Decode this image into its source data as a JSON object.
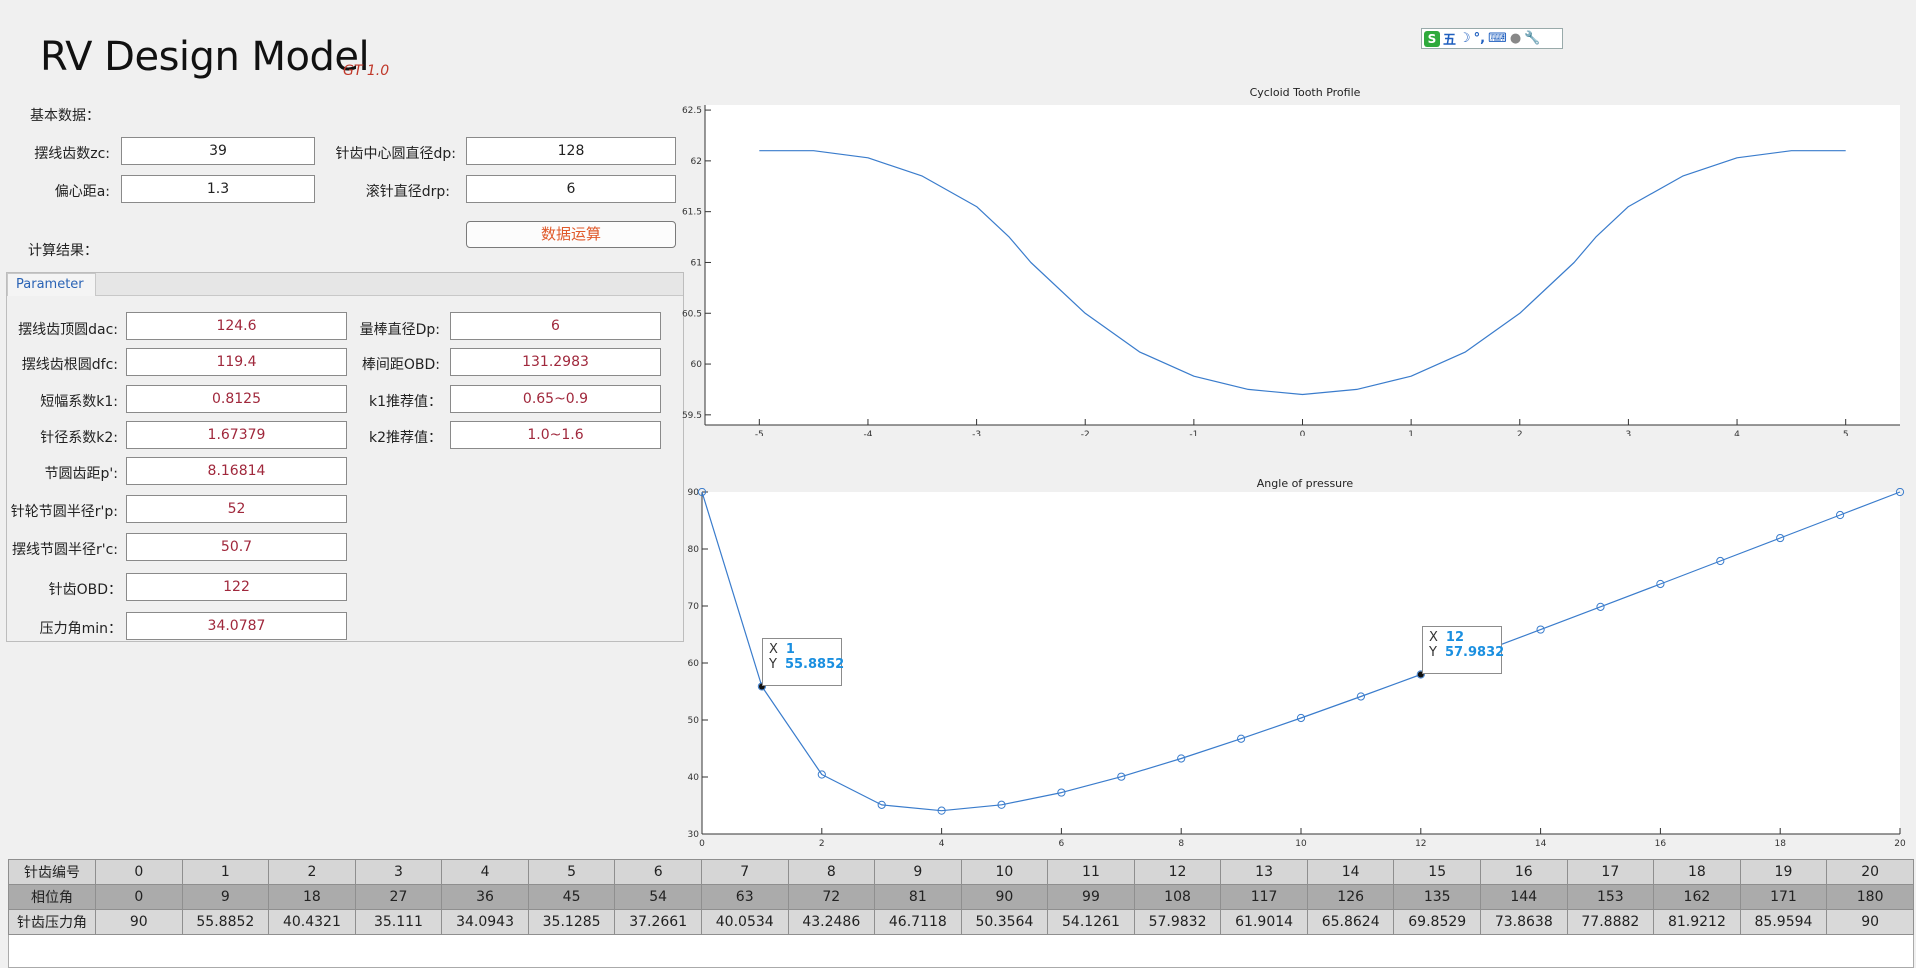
{
  "app": {
    "title": "RV Design Model",
    "version": "GT 1.0"
  },
  "ime": {
    "logo": "S",
    "mode": "五",
    "moon": "☽",
    "punct": "°,",
    "keyboard": "⌨",
    "user": "●",
    "tool": "🔧"
  },
  "basic": {
    "heading": "基本数据：",
    "zc_label": "摆线齿数zc:",
    "zc": "39",
    "dp_label": "针齿中心圆直径dp:",
    "dp": "128",
    "a_label": "偏心距a:",
    "a": "1.3",
    "drp_label": "滚针直径drp:",
    "drp": "6",
    "calc_button": "数据运算"
  },
  "results": {
    "heading": "计算结果：",
    "tab": "Parameter",
    "dac_label": "摆线齿顶圆dac:",
    "dac": "124.6",
    "Dp_label": "量棒直径Dp:",
    "Dp": "6",
    "dfc_label": "摆线齿根圆dfc:",
    "dfc": "119.4",
    "OBD_label": "棒间距OBD:",
    "OBD": "131.2983",
    "k1_label": "短幅系数k1:",
    "k1": "0.8125",
    "k1r_label": "k1推荐值：",
    "k1r": "0.65~0.9",
    "k2_label": "针径系数k2:",
    "k2": "1.67379",
    "k2r_label": "k2推荐值：",
    "k2r": "1.0~1.6",
    "pitch_label": "节圆齿距p':",
    "pitch": "8.16814",
    "rp_label": "针轮节圆半径r'p:",
    "rp": "52",
    "rc_label": "摆线节圆半径r'c:",
    "rc": "50.7",
    "pinOBD_label": "针齿OBD：",
    "pinOBD": "122",
    "amin_label": "压力角min：",
    "amin": "34.0787"
  },
  "chart_data": [
    {
      "type": "line",
      "title": "Cycloid Tooth Profile",
      "xlim": [
        -5.5,
        5.5
      ],
      "ylim": [
        59.4,
        62.55
      ],
      "xticks": [
        "-5",
        "-4",
        "-3",
        "-2",
        "-1",
        "0",
        "1",
        "2",
        "3",
        "4",
        "5"
      ],
      "yticks": [
        "59.5",
        "60",
        "60.5",
        "61",
        "61.5",
        "62",
        "62.5"
      ],
      "x": [
        -5.0,
        -4.5,
        -4.0,
        -3.5,
        -3.0,
        -2.7,
        -2.5,
        -2.0,
        -1.5,
        -1.0,
        -0.5,
        0.0,
        0.5,
        1.0,
        1.5,
        2.0,
        2.5,
        2.7,
        3.0,
        3.5,
        4.0,
        4.5,
        5.0
      ],
      "y": [
        62.1,
        62.1,
        62.03,
        61.85,
        61.55,
        61.25,
        61.0,
        60.5,
        60.12,
        59.88,
        59.75,
        59.7,
        59.75,
        59.88,
        60.12,
        60.5,
        61.0,
        61.25,
        61.55,
        61.85,
        62.03,
        62.1,
        62.1
      ],
      "grid": false
    },
    {
      "type": "line",
      "title": "Angle of pressure",
      "xlim": [
        0,
        20
      ],
      "ylim": [
        30,
        90
      ],
      "xticks": [
        "0",
        "2",
        "4",
        "6",
        "8",
        "10",
        "12",
        "14",
        "16",
        "18",
        "20"
      ],
      "yticks": [
        "30",
        "40",
        "50",
        "60",
        "70",
        "80",
        "90"
      ],
      "x": [
        0,
        1,
        2,
        3,
        4,
        5,
        6,
        7,
        8,
        9,
        10,
        11,
        12,
        13,
        14,
        15,
        16,
        17,
        18,
        19,
        20
      ],
      "y": [
        90,
        55.8852,
        40.4321,
        35.111,
        34.0943,
        35.1285,
        37.2661,
        40.0534,
        43.2486,
        46.7118,
        50.3564,
        54.1261,
        57.9832,
        61.9014,
        65.8624,
        69.8529,
        73.8638,
        77.8882,
        81.9212,
        85.9594,
        90
      ],
      "markers": "circle",
      "grid": false,
      "datatips": [
        {
          "x_label": "X",
          "x": "1",
          "y_label": "Y",
          "y": "55.8852"
        },
        {
          "x_label": "X",
          "x": "12",
          "y_label": "Y",
          "y": "57.9832"
        }
      ]
    }
  ],
  "table": {
    "row_headers": [
      "针齿编号",
      "相位角",
      "针齿压力角"
    ],
    "pin_no": [
      "0",
      "1",
      "2",
      "3",
      "4",
      "5",
      "6",
      "7",
      "8",
      "9",
      "10",
      "11",
      "12",
      "13",
      "14",
      "15",
      "16",
      "17",
      "18",
      "19",
      "20"
    ],
    "phase": [
      "0",
      "9",
      "18",
      "27",
      "36",
      "45",
      "54",
      "63",
      "72",
      "81",
      "90",
      "99",
      "108",
      "117",
      "126",
      "135",
      "144",
      "153",
      "162",
      "171",
      "180"
    ],
    "pressure": [
      "90",
      "55.8852",
      "40.4321",
      "35.111",
      "34.0943",
      "35.1285",
      "37.2661",
      "40.0534",
      "43.2486",
      "46.7118",
      "50.3564",
      "54.1261",
      "57.9832",
      "61.9014",
      "65.8624",
      "69.8529",
      "73.8638",
      "77.8882",
      "81.9212",
      "85.9594",
      "90"
    ]
  },
  "colors": {
    "line": "#3a7ccc",
    "result_text": "#a0283c",
    "button_text": "#e0592a",
    "datatip_value": "#1a8fe0"
  }
}
